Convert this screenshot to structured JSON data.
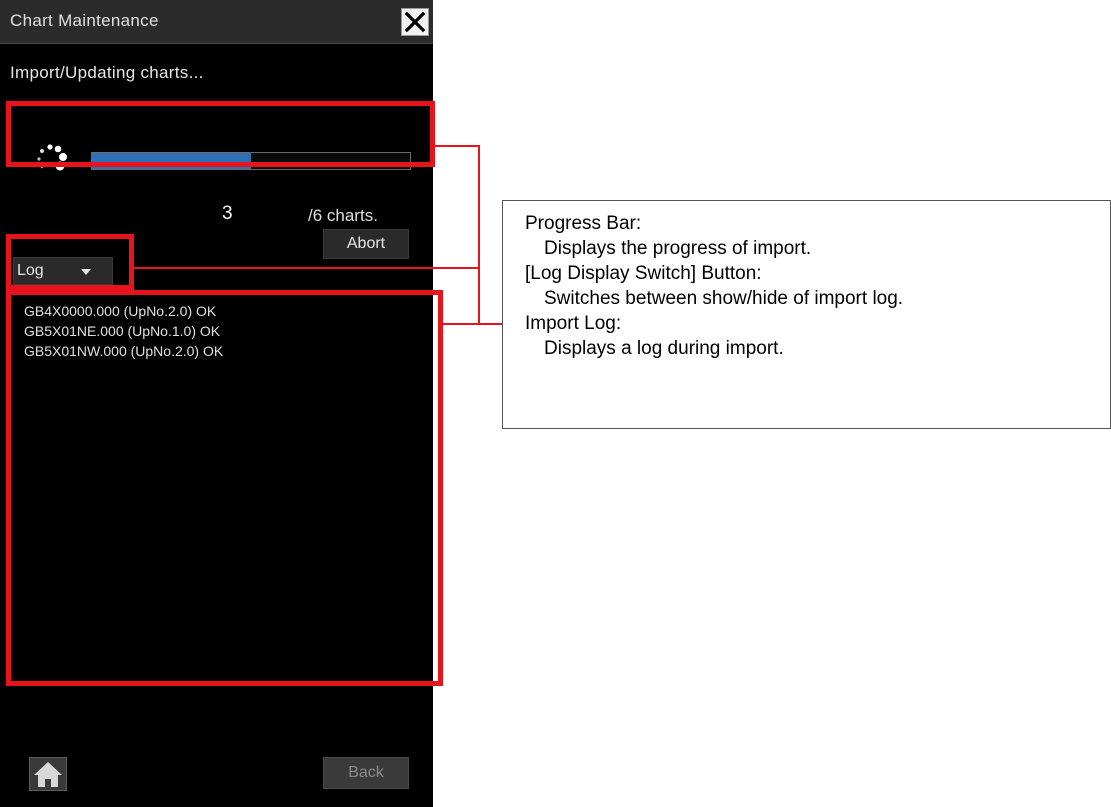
{
  "window": {
    "title": "Chart Maintenance"
  },
  "status_text": "Import/Updating charts...",
  "progress": {
    "fraction": 0.5,
    "current": "3",
    "total_label": "/6 charts."
  },
  "buttons": {
    "abort": "Abort",
    "log_toggle": "Log",
    "back": "Back"
  },
  "log_entries": [
    "GB4X0000.000 (UpNo.2.0) OK",
    "GB5X01NE.000 (UpNo.1.0) OK",
    "GB5X01NW.000 (UpNo.2.0) OK"
  ],
  "callout": {
    "items": [
      {
        "title": "Progress Bar:",
        "desc": "Displays the progress of import."
      },
      {
        "title": "[Log Display Switch] Button:",
        "desc": "Switches between show/hide of import log."
      },
      {
        "title": "Import Log:",
        "desc": "Displays a log during import."
      }
    ]
  },
  "colors": {
    "highlight": "#e8141c",
    "progress_fill": "#2f6fb5",
    "panel_background": "#000000"
  },
  "icons": [
    "close-icon",
    "spinner-icon",
    "dropdown-caret-icon",
    "home-icon"
  ]
}
